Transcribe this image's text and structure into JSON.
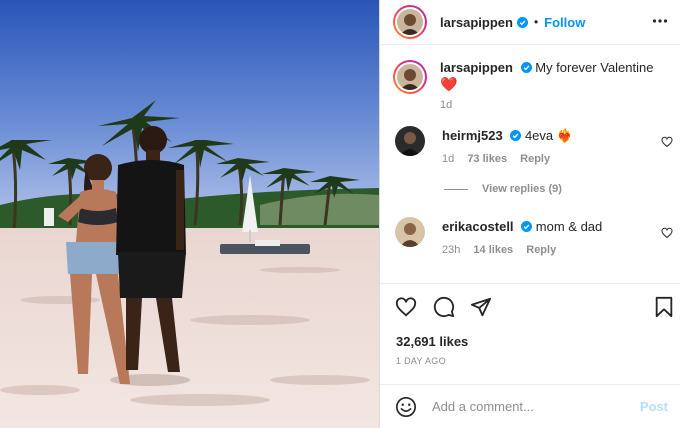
{
  "post": {
    "username": "larsapippen",
    "follow_label": "Follow",
    "dot": "•",
    "caption": {
      "username": "larsapippen",
      "text": "My forever Valentine",
      "emoji": "❤️",
      "time": "1d"
    },
    "comments": [
      {
        "username": "heirmj523",
        "text": "4eva",
        "emoji": "❤️‍🔥",
        "time": "1d",
        "likes": "73 likes",
        "reply_label": "Reply"
      },
      {
        "username": "erikacostell",
        "text": "mom & dad",
        "time": "23h",
        "likes": "14 likes",
        "reply_label": "Reply"
      }
    ],
    "view_replies": "View replies (9)",
    "likes": "32,691 likes",
    "date": "1 DAY AGO",
    "add_comment_placeholder": "Add a comment...",
    "post_label": "Post"
  },
  "icons": {
    "verified": "verified-badge-icon",
    "more": "more-options-icon",
    "like": "heart-icon",
    "comment": "comment-icon",
    "share": "share-icon",
    "save": "bookmark-icon",
    "emoji": "emoji-icon"
  },
  "colors": {
    "accent": "#0095f6",
    "post_disabled": "#b2dffc",
    "muted": "#8e8e8e",
    "text": "#262626",
    "emoji_heart": "#ed4956"
  }
}
